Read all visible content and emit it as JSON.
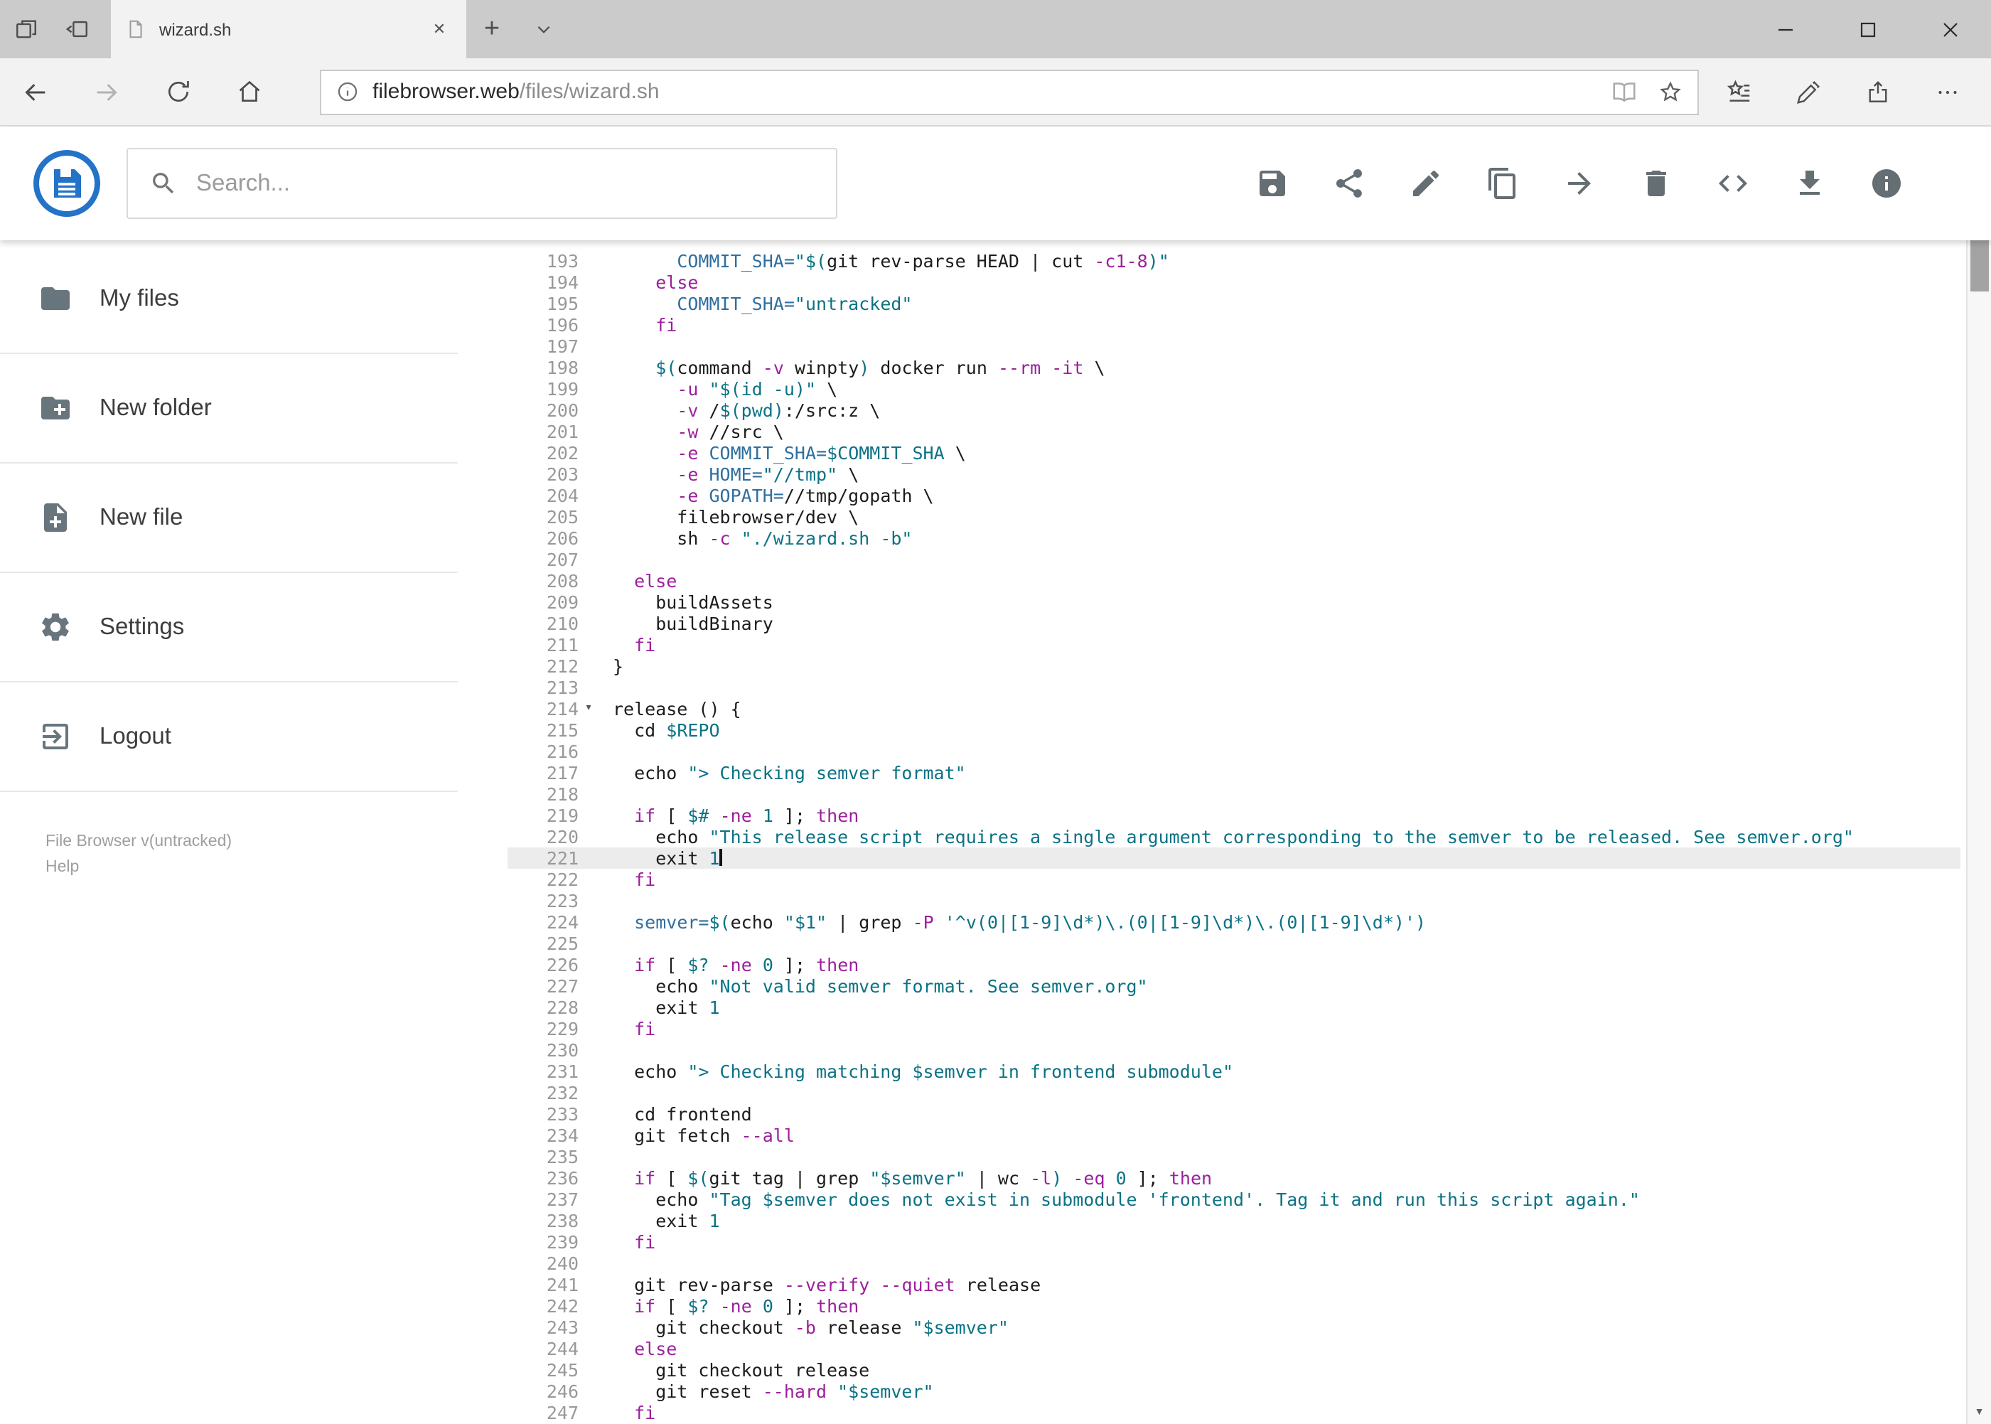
{
  "browser": {
    "tab_title": "wizard.sh",
    "url_host": "filebrowser.web",
    "url_path": "/files/wizard.sh",
    "tab_icons": [
      "tabs-aside-list-icon",
      "set-tabs-aside-icon",
      "page-favicon-icon",
      "tab-close-icon",
      "new-tab-icon",
      "tab-list-chevron-icon"
    ],
    "window_icons": [
      "minimize-icon",
      "maximize-icon",
      "close-icon"
    ],
    "nav_icons": [
      "back-icon",
      "forward-icon",
      "refresh-icon",
      "home-icon"
    ],
    "address_icons": [
      "info-icon",
      "reading-view-icon",
      "favorite-star-icon"
    ],
    "toolbar_icons": [
      "hub-icon",
      "web-note-icon",
      "share-icon",
      "more-icon"
    ]
  },
  "header": {
    "search_placeholder": "Search...",
    "action_icons": [
      "save-icon",
      "share-icon",
      "edit-icon",
      "copy-icon",
      "move-icon",
      "delete-icon",
      "code-icon",
      "download-icon",
      "info-icon"
    ]
  },
  "sidebar": {
    "items": [
      {
        "label": "My files",
        "icon": "folder-icon"
      },
      {
        "label": "New folder",
        "icon": "new-folder-icon"
      },
      {
        "label": "New file",
        "icon": "new-file-icon"
      },
      {
        "label": "Settings",
        "icon": "settings-gear-icon"
      },
      {
        "label": "Logout",
        "icon": "logout-icon"
      }
    ],
    "footer_version": "File Browser v(untracked)",
    "footer_help": "Help"
  },
  "colors": {
    "accent": "#2373c8"
  },
  "editor": {
    "first_line": 193,
    "active_line": 221,
    "fold_line": 214,
    "colors": {
      "keyword": "#9c1f9c",
      "string": "#0b7285",
      "def": "#2f6f9f",
      "default": "#1c1c1c"
    },
    "lines": [
      {
        "n": 193,
        "seg": [
          [
            "d",
            "      "
          ],
          [
            "v",
            "COMMIT_SHA="
          ],
          [
            "s",
            "\"$("
          ],
          [
            "d",
            "git rev-parse HEAD | cut "
          ],
          [
            "k",
            "-c1-8"
          ],
          [
            "s",
            ")\""
          ]
        ]
      },
      {
        "n": 194,
        "seg": [
          [
            "d",
            "    "
          ],
          [
            "k",
            "else"
          ]
        ]
      },
      {
        "n": 195,
        "seg": [
          [
            "d",
            "      "
          ],
          [
            "v",
            "COMMIT_SHA="
          ],
          [
            "s",
            "\"untracked\""
          ]
        ]
      },
      {
        "n": 196,
        "seg": [
          [
            "d",
            "    "
          ],
          [
            "k",
            "fi"
          ]
        ]
      },
      {
        "n": 197,
        "seg": []
      },
      {
        "n": 198,
        "seg": [
          [
            "d",
            "    "
          ],
          [
            "s",
            "$("
          ],
          [
            "d",
            "command "
          ],
          [
            "k",
            "-v"
          ],
          [
            "d",
            " winpty"
          ],
          [
            "s",
            ")"
          ],
          [
            "d",
            " docker run "
          ],
          [
            "k",
            "--rm"
          ],
          [
            "d",
            " "
          ],
          [
            "k",
            "-it"
          ],
          [
            "d",
            " \\"
          ]
        ]
      },
      {
        "n": 199,
        "seg": [
          [
            "d",
            "      "
          ],
          [
            "k",
            "-u"
          ],
          [
            "d",
            " "
          ],
          [
            "s",
            "\"$(id -u)\""
          ],
          [
            "d",
            " \\"
          ]
        ]
      },
      {
        "n": 200,
        "seg": [
          [
            "d",
            "      "
          ],
          [
            "k",
            "-v"
          ],
          [
            "d",
            " /"
          ],
          [
            "s",
            "$(pwd)"
          ],
          [
            "d",
            ":/src:z \\"
          ]
        ]
      },
      {
        "n": 201,
        "seg": [
          [
            "d",
            "      "
          ],
          [
            "k",
            "-w"
          ],
          [
            "d",
            " //src \\"
          ]
        ]
      },
      {
        "n": 202,
        "seg": [
          [
            "d",
            "      "
          ],
          [
            "k",
            "-e"
          ],
          [
            "d",
            " "
          ],
          [
            "v",
            "COMMIT_SHA="
          ],
          [
            "s",
            "$COMMIT_SHA"
          ],
          [
            "d",
            " \\"
          ]
        ]
      },
      {
        "n": 203,
        "seg": [
          [
            "d",
            "      "
          ],
          [
            "k",
            "-e"
          ],
          [
            "d",
            " "
          ],
          [
            "v",
            "HOME="
          ],
          [
            "s",
            "\"//tmp\""
          ],
          [
            "d",
            " \\"
          ]
        ]
      },
      {
        "n": 204,
        "seg": [
          [
            "d",
            "      "
          ],
          [
            "k",
            "-e"
          ],
          [
            "d",
            " "
          ],
          [
            "v",
            "GOPATH="
          ],
          [
            "d",
            "//tmp/gopath \\"
          ]
        ]
      },
      {
        "n": 205,
        "seg": [
          [
            "d",
            "      filebrowser/dev \\"
          ]
        ]
      },
      {
        "n": 206,
        "seg": [
          [
            "d",
            "      sh "
          ],
          [
            "k",
            "-c"
          ],
          [
            "d",
            " "
          ],
          [
            "s",
            "\"./wizard.sh -b\""
          ]
        ]
      },
      {
        "n": 207,
        "seg": []
      },
      {
        "n": 208,
        "seg": [
          [
            "d",
            "  "
          ],
          [
            "k",
            "else"
          ]
        ]
      },
      {
        "n": 209,
        "seg": [
          [
            "d",
            "    buildAssets"
          ]
        ]
      },
      {
        "n": 210,
        "seg": [
          [
            "d",
            "    buildBinary"
          ]
        ]
      },
      {
        "n": 211,
        "seg": [
          [
            "d",
            "  "
          ],
          [
            "k",
            "fi"
          ]
        ]
      },
      {
        "n": 212,
        "seg": [
          [
            "d",
            "}"
          ]
        ]
      },
      {
        "n": 213,
        "seg": []
      },
      {
        "n": 214,
        "seg": [
          [
            "d",
            "release () {"
          ]
        ]
      },
      {
        "n": 215,
        "seg": [
          [
            "d",
            "  cd "
          ],
          [
            "s",
            "$REPO"
          ]
        ]
      },
      {
        "n": 216,
        "seg": []
      },
      {
        "n": 217,
        "seg": [
          [
            "d",
            "  echo "
          ],
          [
            "s",
            "\"> Checking semver format\""
          ]
        ]
      },
      {
        "n": 218,
        "seg": []
      },
      {
        "n": 219,
        "seg": [
          [
            "d",
            "  "
          ],
          [
            "k",
            "if"
          ],
          [
            "d",
            " [ "
          ],
          [
            "s",
            "$#"
          ],
          [
            "d",
            " "
          ],
          [
            "k",
            "-ne"
          ],
          [
            "d",
            " "
          ],
          [
            "s",
            "1"
          ],
          [
            "d",
            " ]; "
          ],
          [
            "k",
            "then"
          ]
        ]
      },
      {
        "n": 220,
        "seg": [
          [
            "d",
            "    echo "
          ],
          [
            "s",
            "\"This release script requires a single argument corresponding to the semver to be released. See semver.org\""
          ]
        ]
      },
      {
        "n": 221,
        "seg": [
          [
            "d",
            "    exit "
          ],
          [
            "s",
            "1"
          ]
        ]
      },
      {
        "n": 222,
        "seg": [
          [
            "d",
            "  "
          ],
          [
            "k",
            "fi"
          ]
        ]
      },
      {
        "n": 223,
        "seg": []
      },
      {
        "n": 224,
        "seg": [
          [
            "d",
            "  "
          ],
          [
            "v",
            "semver="
          ],
          [
            "s",
            "$("
          ],
          [
            "d",
            "echo "
          ],
          [
            "s",
            "\"$1\""
          ],
          [
            "d",
            " | grep "
          ],
          [
            "k",
            "-P"
          ],
          [
            "d",
            " "
          ],
          [
            "s",
            "'^v(0|[1-9]\\d*)\\.(0|[1-9]\\d*)\\.(0|[1-9]\\d*)'"
          ],
          [
            "s",
            ")"
          ]
        ]
      },
      {
        "n": 225,
        "seg": []
      },
      {
        "n": 226,
        "seg": [
          [
            "d",
            "  "
          ],
          [
            "k",
            "if"
          ],
          [
            "d",
            " [ "
          ],
          [
            "s",
            "$?"
          ],
          [
            "d",
            " "
          ],
          [
            "k",
            "-ne"
          ],
          [
            "d",
            " "
          ],
          [
            "s",
            "0"
          ],
          [
            "d",
            " ]; "
          ],
          [
            "k",
            "then"
          ]
        ]
      },
      {
        "n": 227,
        "seg": [
          [
            "d",
            "    echo "
          ],
          [
            "s",
            "\"Not valid semver format. See semver.org\""
          ]
        ]
      },
      {
        "n": 228,
        "seg": [
          [
            "d",
            "    exit "
          ],
          [
            "s",
            "1"
          ]
        ]
      },
      {
        "n": 229,
        "seg": [
          [
            "d",
            "  "
          ],
          [
            "k",
            "fi"
          ]
        ]
      },
      {
        "n": 230,
        "seg": []
      },
      {
        "n": 231,
        "seg": [
          [
            "d",
            "  echo "
          ],
          [
            "s",
            "\"> Checking matching $semver in frontend submodule\""
          ]
        ]
      },
      {
        "n": 232,
        "seg": []
      },
      {
        "n": 233,
        "seg": [
          [
            "d",
            "  cd frontend"
          ]
        ]
      },
      {
        "n": 234,
        "seg": [
          [
            "d",
            "  git fetch "
          ],
          [
            "k",
            "--all"
          ]
        ]
      },
      {
        "n": 235,
        "seg": []
      },
      {
        "n": 236,
        "seg": [
          [
            "d",
            "  "
          ],
          [
            "k",
            "if"
          ],
          [
            "d",
            " [ "
          ],
          [
            "s",
            "$("
          ],
          [
            "d",
            "git tag | grep "
          ],
          [
            "s",
            "\"$semver\""
          ],
          [
            "d",
            " | wc "
          ],
          [
            "k",
            "-l"
          ],
          [
            "s",
            ")"
          ],
          [
            "d",
            " "
          ],
          [
            "k",
            "-eq"
          ],
          [
            "d",
            " "
          ],
          [
            "s",
            "0"
          ],
          [
            "d",
            " ]; "
          ],
          [
            "k",
            "then"
          ]
        ]
      },
      {
        "n": 237,
        "seg": [
          [
            "d",
            "    echo "
          ],
          [
            "s",
            "\"Tag $semver does not exist in submodule 'frontend'. Tag it and run this script again.\""
          ]
        ]
      },
      {
        "n": 238,
        "seg": [
          [
            "d",
            "    exit "
          ],
          [
            "s",
            "1"
          ]
        ]
      },
      {
        "n": 239,
        "seg": [
          [
            "d",
            "  "
          ],
          [
            "k",
            "fi"
          ]
        ]
      },
      {
        "n": 240,
        "seg": []
      },
      {
        "n": 241,
        "seg": [
          [
            "d",
            "  git rev-parse "
          ],
          [
            "k",
            "--verify"
          ],
          [
            "d",
            " "
          ],
          [
            "k",
            "--quiet"
          ],
          [
            "d",
            " release"
          ]
        ]
      },
      {
        "n": 242,
        "seg": [
          [
            "d",
            "  "
          ],
          [
            "k",
            "if"
          ],
          [
            "d",
            " [ "
          ],
          [
            "s",
            "$?"
          ],
          [
            "d",
            " "
          ],
          [
            "k",
            "-ne"
          ],
          [
            "d",
            " "
          ],
          [
            "s",
            "0"
          ],
          [
            "d",
            " ]; "
          ],
          [
            "k",
            "then"
          ]
        ]
      },
      {
        "n": 243,
        "seg": [
          [
            "d",
            "    git checkout "
          ],
          [
            "k",
            "-b"
          ],
          [
            "d",
            " release "
          ],
          [
            "s",
            "\"$semver\""
          ]
        ]
      },
      {
        "n": 244,
        "seg": [
          [
            "d",
            "  "
          ],
          [
            "k",
            "else"
          ]
        ]
      },
      {
        "n": 245,
        "seg": [
          [
            "d",
            "    git checkout release"
          ]
        ]
      },
      {
        "n": 246,
        "seg": [
          [
            "d",
            "    git reset "
          ],
          [
            "k",
            "--hard"
          ],
          [
            "d",
            " "
          ],
          [
            "s",
            "\"$semver\""
          ]
        ]
      },
      {
        "n": 247,
        "seg": [
          [
            "d",
            "  "
          ],
          [
            "k",
            "fi"
          ]
        ]
      }
    ]
  }
}
